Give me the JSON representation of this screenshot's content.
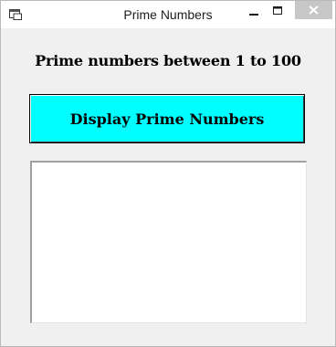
{
  "window": {
    "title": "Prime Numbers"
  },
  "form": {
    "heading": "Prime numbers between 1 to 100",
    "display_button_label": "Display Prime Numbers",
    "button_color": "#00ffff",
    "listbox_items": []
  },
  "icons": {
    "app": "form-window-icon",
    "minimize": "minimize-icon",
    "maximize": "maximize-icon",
    "close": "close-icon"
  }
}
